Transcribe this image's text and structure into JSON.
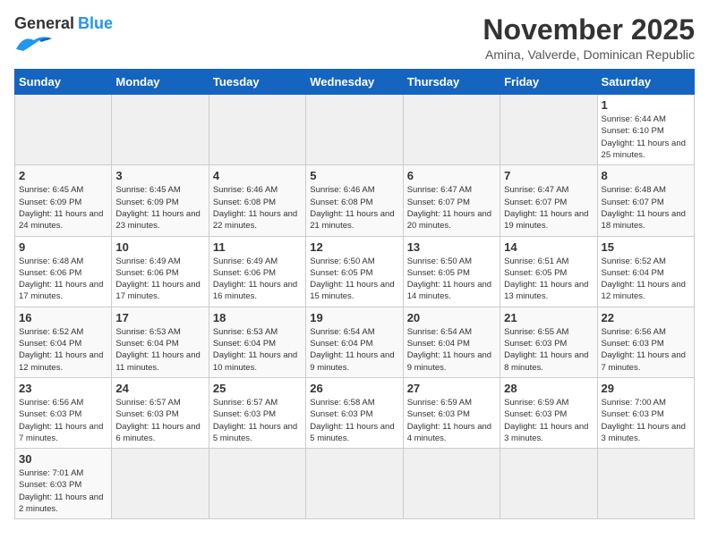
{
  "header": {
    "logo_general": "General",
    "logo_blue": "Blue",
    "month": "November 2025",
    "location": "Amina, Valverde, Dominican Republic"
  },
  "days_of_week": [
    "Sunday",
    "Monday",
    "Tuesday",
    "Wednesday",
    "Thursday",
    "Friday",
    "Saturday"
  ],
  "weeks": [
    [
      {
        "day": "",
        "info": ""
      },
      {
        "day": "",
        "info": ""
      },
      {
        "day": "",
        "info": ""
      },
      {
        "day": "",
        "info": ""
      },
      {
        "day": "",
        "info": ""
      },
      {
        "day": "",
        "info": ""
      },
      {
        "day": "1",
        "info": "Sunrise: 6:44 AM\nSunset: 6:10 PM\nDaylight: 11 hours\nand 25 minutes."
      }
    ],
    [
      {
        "day": "2",
        "info": "Sunrise: 6:45 AM\nSunset: 6:09 PM\nDaylight: 11 hours\nand 24 minutes."
      },
      {
        "day": "3",
        "info": "Sunrise: 6:45 AM\nSunset: 6:09 PM\nDaylight: 11 hours\nand 23 minutes."
      },
      {
        "day": "4",
        "info": "Sunrise: 6:46 AM\nSunset: 6:08 PM\nDaylight: 11 hours\nand 22 minutes."
      },
      {
        "day": "5",
        "info": "Sunrise: 6:46 AM\nSunset: 6:08 PM\nDaylight: 11 hours\nand 21 minutes."
      },
      {
        "day": "6",
        "info": "Sunrise: 6:47 AM\nSunset: 6:07 PM\nDaylight: 11 hours\nand 20 minutes."
      },
      {
        "day": "7",
        "info": "Sunrise: 6:47 AM\nSunset: 6:07 PM\nDaylight: 11 hours\nand 19 minutes."
      },
      {
        "day": "8",
        "info": "Sunrise: 6:48 AM\nSunset: 6:07 PM\nDaylight: 11 hours\nand 18 minutes."
      }
    ],
    [
      {
        "day": "9",
        "info": "Sunrise: 6:48 AM\nSunset: 6:06 PM\nDaylight: 11 hours\nand 17 minutes."
      },
      {
        "day": "10",
        "info": "Sunrise: 6:49 AM\nSunset: 6:06 PM\nDaylight: 11 hours\nand 17 minutes."
      },
      {
        "day": "11",
        "info": "Sunrise: 6:49 AM\nSunset: 6:06 PM\nDaylight: 11 hours\nand 16 minutes."
      },
      {
        "day": "12",
        "info": "Sunrise: 6:50 AM\nSunset: 6:05 PM\nDaylight: 11 hours\nand 15 minutes."
      },
      {
        "day": "13",
        "info": "Sunrise: 6:50 AM\nSunset: 6:05 PM\nDaylight: 11 hours\nand 14 minutes."
      },
      {
        "day": "14",
        "info": "Sunrise: 6:51 AM\nSunset: 6:05 PM\nDaylight: 11 hours\nand 13 minutes."
      },
      {
        "day": "15",
        "info": "Sunrise: 6:52 AM\nSunset: 6:04 PM\nDaylight: 11 hours\nand 12 minutes."
      }
    ],
    [
      {
        "day": "16",
        "info": "Sunrise: 6:52 AM\nSunset: 6:04 PM\nDaylight: 11 hours\nand 12 minutes."
      },
      {
        "day": "17",
        "info": "Sunrise: 6:53 AM\nSunset: 6:04 PM\nDaylight: 11 hours\nand 11 minutes."
      },
      {
        "day": "18",
        "info": "Sunrise: 6:53 AM\nSunset: 6:04 PM\nDaylight: 11 hours\nand 10 minutes."
      },
      {
        "day": "19",
        "info": "Sunrise: 6:54 AM\nSunset: 6:04 PM\nDaylight: 11 hours\nand 9 minutes."
      },
      {
        "day": "20",
        "info": "Sunrise: 6:54 AM\nSunset: 6:04 PM\nDaylight: 11 hours\nand 9 minutes."
      },
      {
        "day": "21",
        "info": "Sunrise: 6:55 AM\nSunset: 6:03 PM\nDaylight: 11 hours\nand 8 minutes."
      },
      {
        "day": "22",
        "info": "Sunrise: 6:56 AM\nSunset: 6:03 PM\nDaylight: 11 hours\nand 7 minutes."
      }
    ],
    [
      {
        "day": "23",
        "info": "Sunrise: 6:56 AM\nSunset: 6:03 PM\nDaylight: 11 hours\nand 7 minutes."
      },
      {
        "day": "24",
        "info": "Sunrise: 6:57 AM\nSunset: 6:03 PM\nDaylight: 11 hours\nand 6 minutes."
      },
      {
        "day": "25",
        "info": "Sunrise: 6:57 AM\nSunset: 6:03 PM\nDaylight: 11 hours\nand 5 minutes."
      },
      {
        "day": "26",
        "info": "Sunrise: 6:58 AM\nSunset: 6:03 PM\nDaylight: 11 hours\nand 5 minutes."
      },
      {
        "day": "27",
        "info": "Sunrise: 6:59 AM\nSunset: 6:03 PM\nDaylight: 11 hours\nand 4 minutes."
      },
      {
        "day": "28",
        "info": "Sunrise: 6:59 AM\nSunset: 6:03 PM\nDaylight: 11 hours\nand 3 minutes."
      },
      {
        "day": "29",
        "info": "Sunrise: 7:00 AM\nSunset: 6:03 PM\nDaylight: 11 hours\nand 3 minutes."
      }
    ],
    [
      {
        "day": "30",
        "info": "Sunrise: 7:01 AM\nSunset: 6:03 PM\nDaylight: 11 hours\nand 2 minutes."
      },
      {
        "day": "",
        "info": ""
      },
      {
        "day": "",
        "info": ""
      },
      {
        "day": "",
        "info": ""
      },
      {
        "day": "",
        "info": ""
      },
      {
        "day": "",
        "info": ""
      },
      {
        "day": "",
        "info": ""
      }
    ]
  ]
}
